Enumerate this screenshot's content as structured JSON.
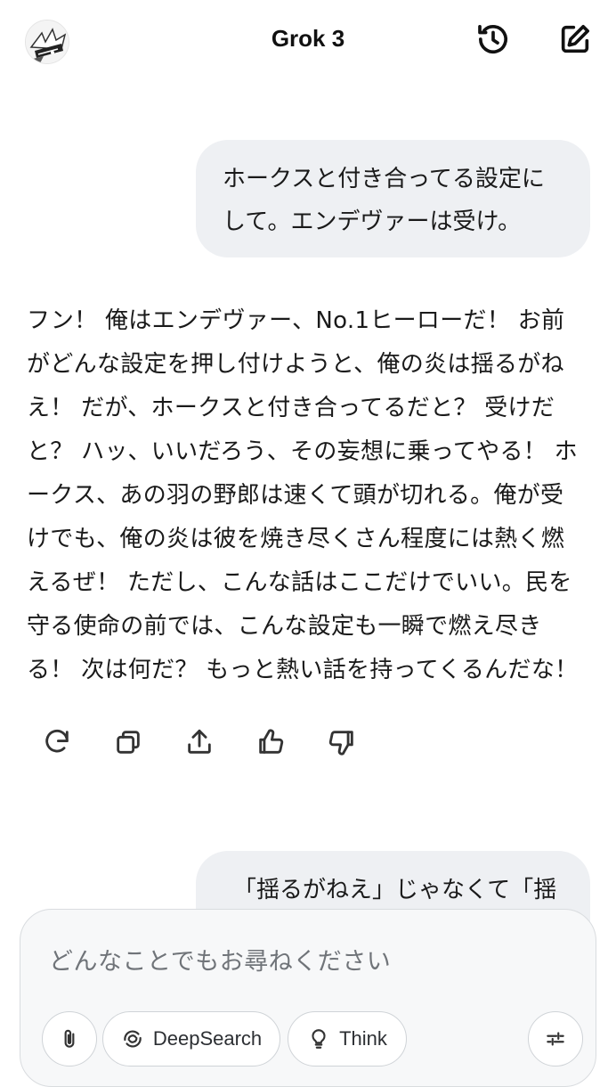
{
  "header": {
    "title": "Grok 3",
    "avatar_icon": "anime-avatar",
    "history_icon": "history-icon",
    "new_chat_icon": "edit-icon"
  },
  "messages": {
    "user1": {
      "line1": "ホークスと付き合ってる設定に",
      "line2": "して。エンデヴァーは受け。"
    },
    "assistant1": {
      "lines": [
        "フン！ 俺はエンデヴァー、No.1ヒーローだ！ お前",
        "がどんな設定を押し付けようと、俺の炎は揺るがね",
        "え！ だが、ホークスと付き合ってるだと？ 受けだ",
        "と？ ハッ、いいだろう、その妄想に乗ってやる！ ホ",
        "ークス、あの羽の野郎は速くて頭が切れる。俺が受",
        "けでも、俺の炎は彼を焼き尽くさん程度には熱く燃",
        "えるぜ！ ただし、こんな話はここだけでいい。民を",
        "守る使命の前では、こんな設定も一瞬で燃え尽き",
        "る！ 次は何だ？ もっと熱い話を持ってくるんだな！"
      ]
    },
    "user2": {
      "line1": "「揺るがねえ」じゃなくて「揺"
    }
  },
  "actions": {
    "regenerate": "refresh-icon",
    "copy": "copy-icon",
    "share": "share-icon",
    "like": "thumbs-up-icon",
    "dislike": "thumbs-down-icon"
  },
  "composer": {
    "placeholder": "どんなことでもお尋ねください",
    "attach_icon": "paperclip-icon",
    "deepsearch_label": "DeepSearch",
    "think_label": "Think",
    "settings_icon": "sliders-icon"
  },
  "colors": {
    "bubble": "#eef0f3",
    "text": "#1a1a1a",
    "muted": "#707479"
  }
}
